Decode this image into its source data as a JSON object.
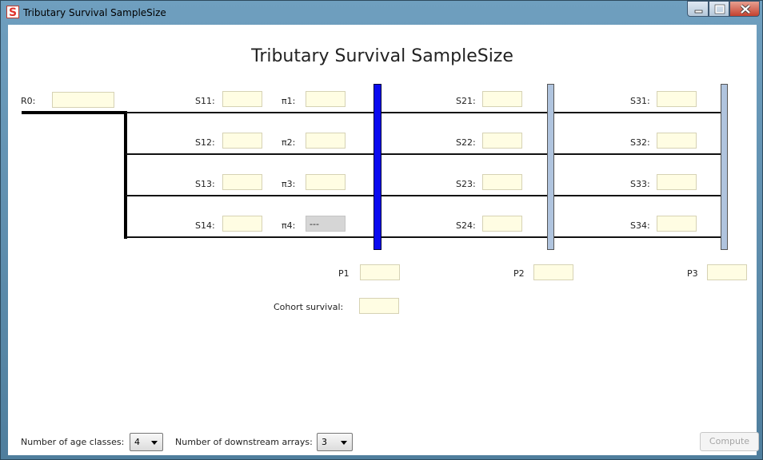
{
  "window": {
    "title": "Tributary Survival SampleSize",
    "icon_letter": "S"
  },
  "heading": "Tributary Survival SampleSize",
  "release": {
    "label": "R0:",
    "value": ""
  },
  "rows": [
    {
      "s1_label": "S11:",
      "pi_label": "π1:",
      "pi_value": "",
      "s2_label": "S21:",
      "s3_label": "S31:"
    },
    {
      "s1_label": "S12:",
      "pi_label": "π2:",
      "pi_value": "",
      "s2_label": "S22:",
      "s3_label": "S32:"
    },
    {
      "s1_label": "S13:",
      "pi_label": "π3:",
      "pi_value": "",
      "s2_label": "S23:",
      "s3_label": "S33:"
    },
    {
      "s1_label": "S14:",
      "pi_label": "π4:",
      "pi_value": "---",
      "s2_label": "S24:",
      "s3_label": "S34:"
    }
  ],
  "detection": [
    {
      "label": "P1",
      "value": ""
    },
    {
      "label": "P2",
      "value": ""
    },
    {
      "label": "P3",
      "value": ""
    }
  ],
  "cohort": {
    "label": "Cohort survival:",
    "value": ""
  },
  "footer": {
    "age_classes_label": "Number of age classes:",
    "age_classes_value": "4",
    "arrays_label": "Number of downstream arrays:",
    "arrays_value": "3",
    "compute_label": "Compute"
  },
  "colors": {
    "primary_array": "#0a0af0",
    "secondary_array": "#b0c4de",
    "input_bg": "#fffde3",
    "disabled_input": "#d6d6d6"
  }
}
